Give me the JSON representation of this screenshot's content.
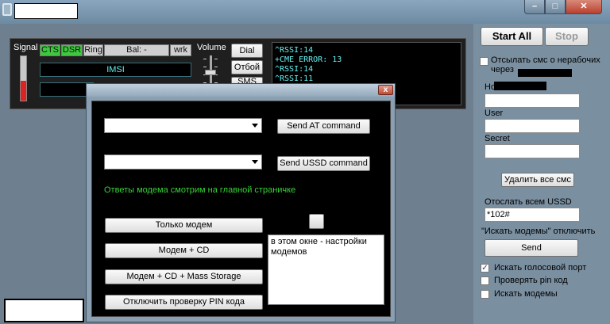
{
  "window": {
    "minimize_glyph": "–",
    "maximize_glyph": "□",
    "close_glyph": "✕"
  },
  "status": {
    "signal_label": "Signal",
    "signal_level_fraction": 0.45,
    "cts": "CTS",
    "dsr": "DSR",
    "ring": "Ring",
    "balance": "Bal: -",
    "wrk": "wrk",
    "imsi": "IMSI",
    "volume_label": "Volume",
    "dial": "Dial",
    "hangup": "Отбой",
    "sms": "SMS",
    "log": [
      "^RSSI:14",
      "+CME ERROR: 13",
      "^RSSI:14",
      "^RSSI:11"
    ]
  },
  "right": {
    "start_all": "Start All",
    "stop": "Stop",
    "send_sms_offline_label": "Отсылать смс о нерабочих через",
    "number_label": "Но",
    "user_label": "User",
    "secret_label": "Secret",
    "delete_sms": "Удалить все смс",
    "ussd_label": "Отослать всем USSD",
    "ussd_value": "*102#",
    "hint": "\"Искать модемы\" отключить",
    "send": "Send",
    "check_voice_port": "Искать голосовой порт",
    "check_pin": "Проверять pin код",
    "check_search": "Искать модемы",
    "check_mark": "✓"
  },
  "dialog": {
    "close_glyph": "x",
    "send_at": "Send AT command",
    "send_ussd": "Send USSD command",
    "note": "Ответы модема смотрим на главной страничке",
    "mode_modem_only": "Только модем",
    "mode_modem_cd": "Модем + CD",
    "mode_modem_cd_storage": "Модем + CD + Mass Storage",
    "disable_pin": "Отключить проверку PIN кода",
    "info": "в этом окне - настройки модемов"
  }
}
